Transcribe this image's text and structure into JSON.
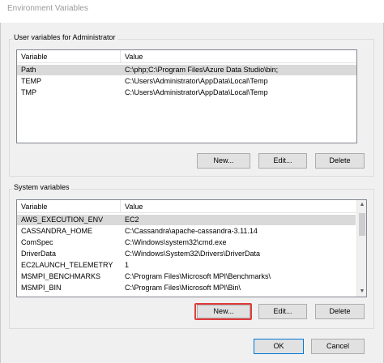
{
  "window": {
    "title": "Environment Variables"
  },
  "user_vars": {
    "label": "User variables for Administrator",
    "columns": [
      "Variable",
      "Value"
    ],
    "rows": [
      {
        "variable": "Path",
        "value": "C:\\php;C:\\Program Files\\Azure Data Studio\\bin;",
        "selected": true
      },
      {
        "variable": "TEMP",
        "value": "C:\\Users\\Administrator\\AppData\\Local\\Temp",
        "selected": false
      },
      {
        "variable": "TMP",
        "value": "C:\\Users\\Administrator\\AppData\\Local\\Temp",
        "selected": false
      }
    ],
    "buttons": {
      "new": "New...",
      "edit": "Edit...",
      "delete": "Delete"
    }
  },
  "system_vars": {
    "label": "System variables",
    "columns": [
      "Variable",
      "Value"
    ],
    "rows": [
      {
        "variable": "AWS_EXECUTION_ENV",
        "value": "EC2",
        "selected": true
      },
      {
        "variable": "CASSANDRA_HOME",
        "value": "C:\\Cassandra\\apache-cassandra-3.11.14",
        "selected": false
      },
      {
        "variable": "ComSpec",
        "value": "C:\\Windows\\system32\\cmd.exe",
        "selected": false
      },
      {
        "variable": "DriverData",
        "value": "C:\\Windows\\System32\\Drivers\\DriverData",
        "selected": false
      },
      {
        "variable": "EC2LAUNCH_TELEMETRY",
        "value": "1",
        "selected": false
      },
      {
        "variable": "MSMPI_BENCHMARKS",
        "value": "C:\\Program Files\\Microsoft MPI\\Benchmarks\\",
        "selected": false
      },
      {
        "variable": "MSMPI_BIN",
        "value": "C:\\Program Files\\Microsoft MPI\\Bin\\",
        "selected": false
      }
    ],
    "buttons": {
      "new": "New...",
      "edit": "Edit...",
      "delete": "Delete"
    }
  },
  "footer": {
    "ok": "OK",
    "cancel": "Cancel"
  },
  "icons": {
    "scroll_up": "scroll-up-arrow-icon",
    "scroll_down": "scroll-down-arrow-icon"
  },
  "colors": {
    "highlight": "#e03c3c",
    "selected_row": "#d9d9d9",
    "primary_border": "#0078d7"
  }
}
